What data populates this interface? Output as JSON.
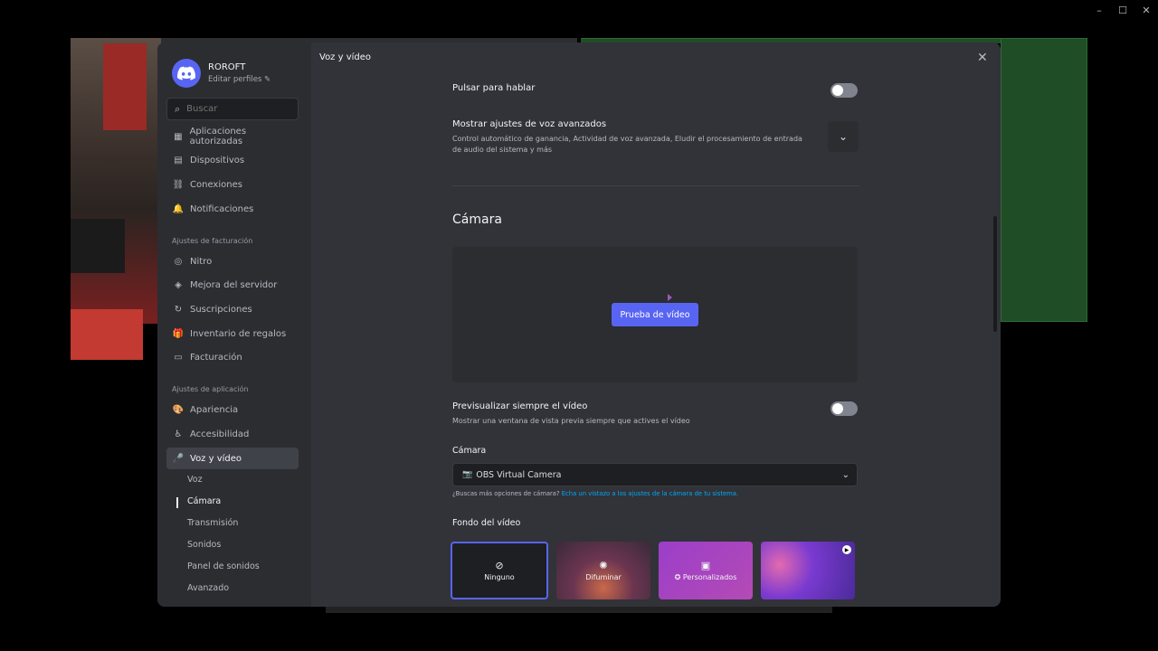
{
  "window_controls": {
    "minimize": "–",
    "maximize": "☐",
    "close": "✕"
  },
  "profile": {
    "name": "ROROFT",
    "edit": "Editar perfiles ✎"
  },
  "search": {
    "placeholder": "Buscar"
  },
  "sidebar": {
    "group1": [
      {
        "icon": "▦",
        "label": "Aplicaciones autorizadas"
      },
      {
        "icon": "▤",
        "label": "Dispositivos"
      },
      {
        "icon": "⛓",
        "label": "Conexiones"
      },
      {
        "icon": "🔔",
        "label": "Notificaciones"
      }
    ],
    "billing_header": "Ajustes de facturación",
    "billing": [
      {
        "icon": "◎",
        "label": "Nitro"
      },
      {
        "icon": "◈",
        "label": "Mejora del servidor"
      },
      {
        "icon": "↻",
        "label": "Suscripciones"
      },
      {
        "icon": "🎁",
        "label": "Inventario de regalos"
      },
      {
        "icon": "▭",
        "label": "Facturación"
      }
    ],
    "app_header": "Ajustes de aplicación",
    "app": [
      {
        "icon": "🎨",
        "label": "Apariencia"
      },
      {
        "icon": "♿",
        "label": "Accesibilidad"
      },
      {
        "icon": "🎤",
        "label": "Voz y vídeo"
      }
    ],
    "sub": [
      "Voz",
      "Cámara",
      "Transmisión",
      "Sonidos",
      "Panel de sonidos",
      "Avanzado"
    ]
  },
  "page": {
    "title": "Voz y vídeo",
    "close": "✕"
  },
  "ptt": {
    "label": "Pulsar para hablar",
    "enabled": false
  },
  "advanced": {
    "title": "Mostrar ajustes de voz avanzados",
    "desc": "Control automático de ganancia, Actividad de voz avanzada, Eludir el procesamiento de entrada de audio del sistema y más",
    "chevron": "⌄"
  },
  "camera_section": {
    "title": "Cámara",
    "test_button": "Prueba de vídeo"
  },
  "always_preview": {
    "title": "Previsualizar siempre el vídeo",
    "desc": "Mostrar una ventana de vista previa siempre que actives el vídeo",
    "enabled": false
  },
  "camera_select": {
    "label": "Cámara",
    "value": "OBS Virtual Camera",
    "hint": "¿Buscas más opciones de cámara?",
    "hint_link": "Echa un vistazo a los ajustes de la cámara de tu sistema."
  },
  "video_bg": {
    "label": "Fondo del vídeo",
    "options": [
      {
        "icon": "⊘",
        "label": "Ninguno"
      },
      {
        "icon": "✺",
        "label": "Difuminar"
      },
      {
        "icon": "▣",
        "label": "✪ Personalizados"
      }
    ]
  }
}
